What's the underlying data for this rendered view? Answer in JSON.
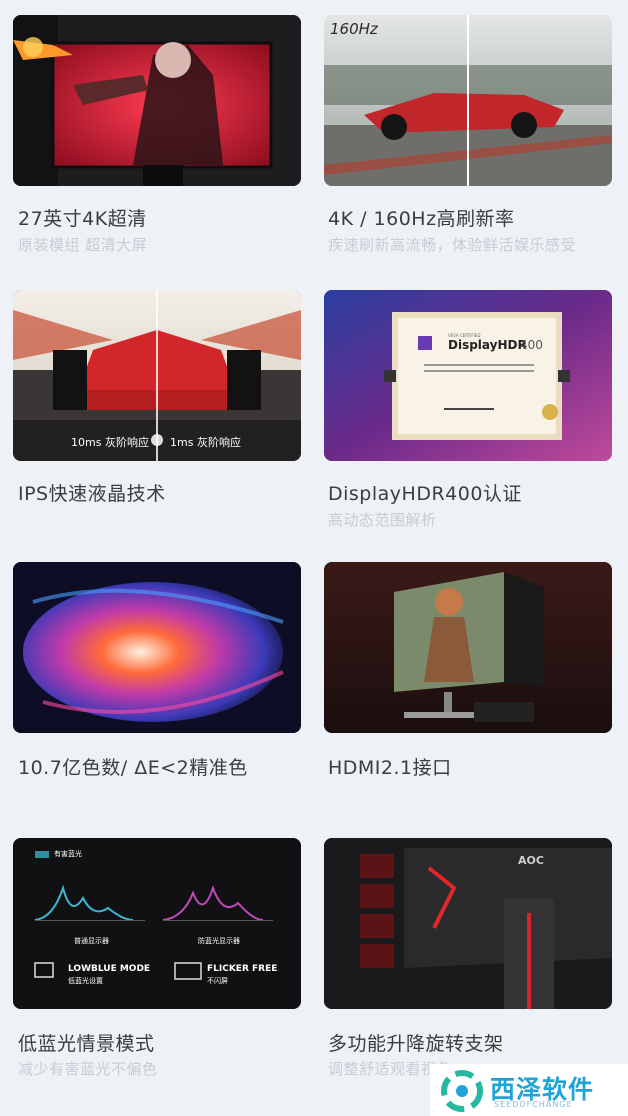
{
  "features": [
    {
      "title": "27英寸4K超清",
      "subtitle": "原装模组 超清大屏"
    },
    {
      "title": "4K / 160Hz高刷新率",
      "subtitle": "疾速刷新高流畅，体验鲜活娱乐感受",
      "overlay": "160Hz"
    },
    {
      "title": "IPS快速液晶技术",
      "subtitle": "",
      "overlay_left": "10ms 灰阶响应",
      "overlay_right": "1ms 灰阶响应"
    },
    {
      "title": "DisplayHDR400认证",
      "subtitle": "高动态范围解析",
      "cert_brand": "DisplayHDR",
      "cert_level": "400",
      "cert_org": "VESA CERTIFIED"
    },
    {
      "title": "10.7亿色数/ ΔE<2精准色",
      "subtitle": ""
    },
    {
      "title": "HDMI2.1接口",
      "subtitle": ""
    },
    {
      "title": "低蓝光情景模式",
      "subtitle": "减少有害蓝光不偏色",
      "panel_header": "有害蓝光",
      "chart_left": "普通显示器",
      "chart_right": "防蓝光显示器",
      "mode1_en": "LOWBLUE MODE",
      "mode1_cn": "低蓝光设置",
      "mode2_en": "FLICKER FREE",
      "mode2_cn": "不闪屏"
    },
    {
      "title": "多功能升降旋转支架",
      "subtitle": "调整舒适观看视角",
      "brand": "AOC"
    }
  ],
  "watermark": {
    "name": "西泽软件",
    "sub": "SEEDOFCHANGE"
  }
}
